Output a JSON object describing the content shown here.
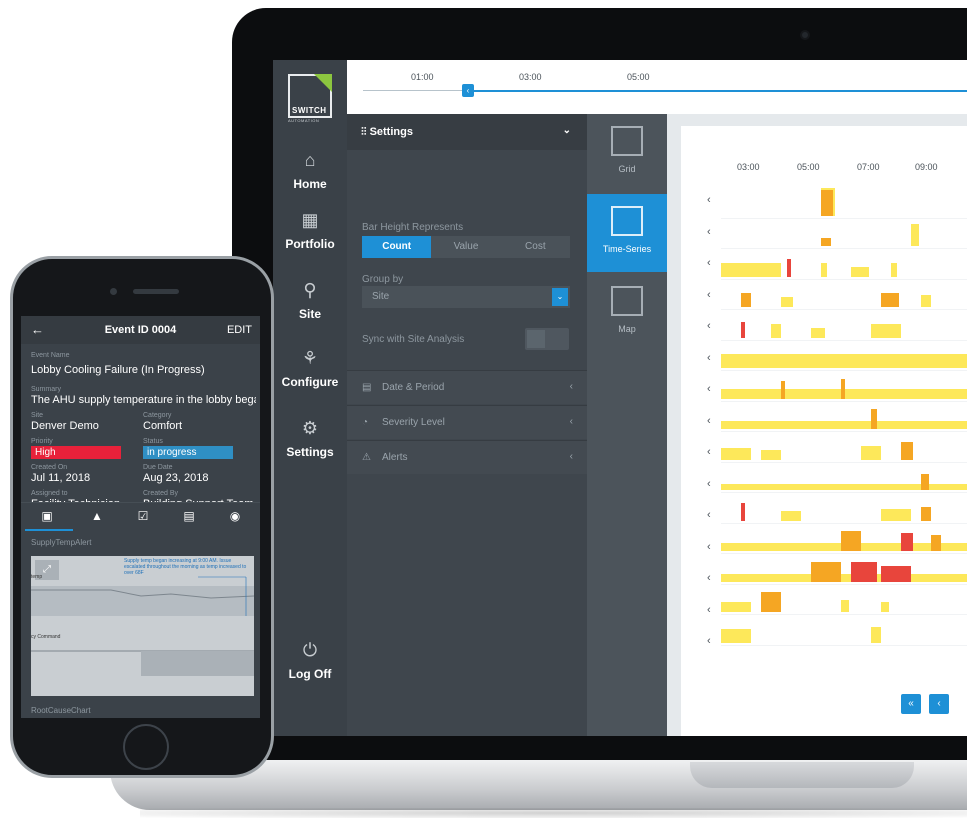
{
  "laptop": {
    "nav": {
      "logo_text": "SWITCH",
      "logo_sub": "AUTOMATION",
      "items": [
        {
          "label": "Home"
        },
        {
          "label": "Portfolio"
        },
        {
          "label": "Site"
        },
        {
          "label": "Configure"
        },
        {
          "label": "Settings"
        },
        {
          "label": "Log Off"
        }
      ]
    },
    "timeline": {
      "ticks": [
        "01:00",
        "03:00",
        "05:00"
      ]
    },
    "settings": {
      "header": "Settings",
      "bar_height_label": "Bar Height Represents",
      "segments": [
        "Count",
        "Value",
        "Cost"
      ],
      "selected_segment": "Count",
      "group_by_label": "Group by",
      "group_by_value": "Site",
      "sync_label": "Sync with Site Analysis",
      "sections": [
        "Date & Period",
        "Severity Level",
        "Alerts"
      ]
    },
    "views": {
      "items": [
        "Grid",
        "Time-Series",
        "Map"
      ],
      "selected": "Time-Series"
    },
    "chart": {
      "time_ticks": [
        "03:00",
        "05:00",
        "07:00",
        "09:00"
      ]
    },
    "pager": {
      "first": "«",
      "prev": "‹"
    }
  },
  "phone": {
    "header": {
      "back": "←",
      "title": "Event ID 0004",
      "edit": "EDIT"
    },
    "fields": {
      "event_name_label": "Event Name",
      "event_name": "Lobby Cooling Failure (In Progress)",
      "summary_label": "Summary",
      "summary": "The AHU supply temperature in the lobby bega...",
      "site_label": "Site",
      "site": "Denver Demo",
      "category_label": "Category",
      "category": "Comfort",
      "priority_label": "Priority",
      "priority": "High",
      "status_label": "Status",
      "status": "in progress",
      "created_on_label": "Created On",
      "created_on": "Jul 11, 2018",
      "due_date_label": "Due Date",
      "due_date": "Aug 23, 2018",
      "assigned_to_label": "Assigned to",
      "assigned_to": "Facility Technician",
      "created_by_label": "Created By",
      "created_by": "Building Support Team"
    },
    "colors": {
      "priority": "#e8213a",
      "status": "#2f8fc4"
    },
    "section_alert": "SupplyTempAlert",
    "annotation": "Supply temp began increasing at 9:00 AM. Issue escalated throughout the morning as temp increased to over 68F",
    "chart_labels": [
      "temp",
      "cy Command"
    ],
    "section_root": "RootCauseChart"
  }
}
